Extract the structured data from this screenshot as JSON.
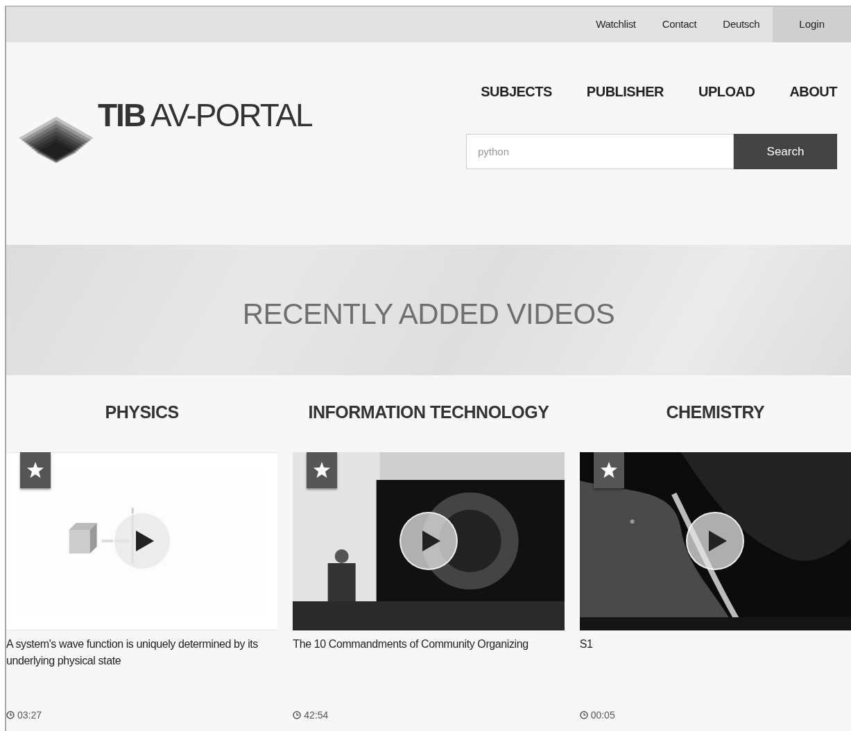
{
  "top_links": [
    "Watchlist",
    "Contact",
    "Deutsch"
  ],
  "login_button": "Login",
  "logo": {
    "bold": "TIB",
    "rest": "AV-PORTAL"
  },
  "nav": [
    "SUBJECTS",
    "PUBLISHER",
    "UPLOAD",
    "ABOUT"
  ],
  "search": {
    "placeholder": "python",
    "button": "Search"
  },
  "banner_title": "RECENTLY ADDED VIDEOS",
  "columns": [
    {
      "category": "PHYSICS",
      "video": {
        "kind": "diagram",
        "title": "A system's wave function is uniquely determined by its underlying physical state",
        "duration": "03:27"
      }
    },
    {
      "category": "INFORMATION TECHNOLOGY",
      "video": {
        "kind": "stage",
        "title": "The 10 Commandments of Community Organizing",
        "duration": "42:54"
      }
    },
    {
      "category": "CHEMISTRY",
      "video": {
        "kind": "microscope",
        "title": "S1",
        "duration": "00:05"
      }
    }
  ]
}
